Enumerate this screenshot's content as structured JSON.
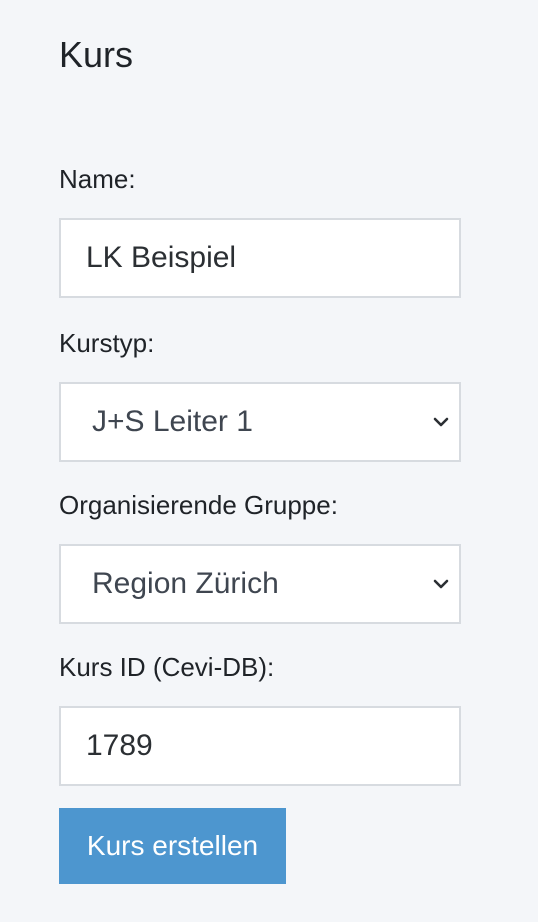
{
  "form": {
    "title": "Kurs",
    "name": {
      "label": "Name:",
      "value": "LK Beispiel"
    },
    "kurstyp": {
      "label": "Kurstyp:",
      "selected": "J+S Leiter 1"
    },
    "gruppe": {
      "label": "Organisierende Gruppe:",
      "selected": "Region Zürich"
    },
    "kurs_id": {
      "label": "Kurs ID (Cevi-DB):",
      "value": "1789"
    },
    "submit_label": "Kurs erstellen"
  },
  "colors": {
    "background": "#f4f6f9",
    "button": "#4d96cf",
    "field_border": "#d7dbe0"
  }
}
